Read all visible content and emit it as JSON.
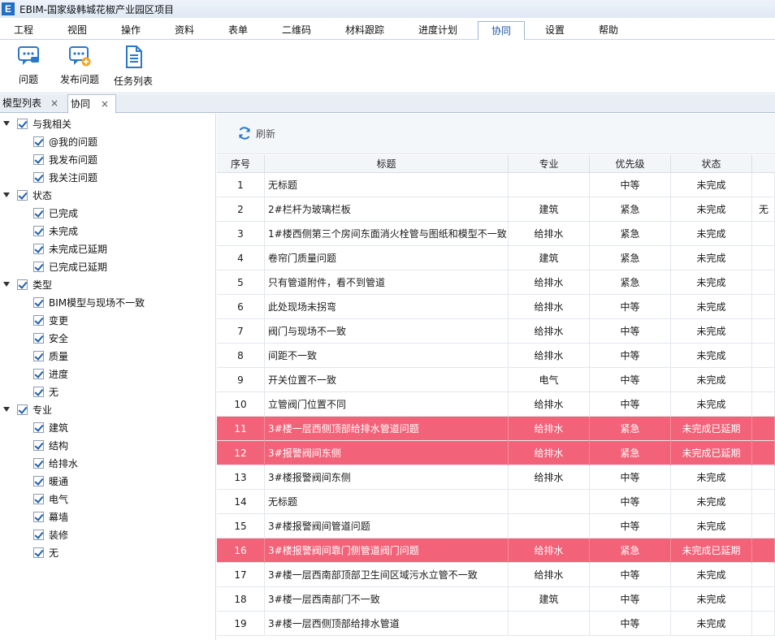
{
  "window": {
    "title": "EBIM-国家级韩城花椒产业园区项目",
    "logo_letter": "E"
  },
  "menu": [
    {
      "label": "工程"
    },
    {
      "label": "视图"
    },
    {
      "label": "操作"
    },
    {
      "label": "资料"
    },
    {
      "label": "表单"
    },
    {
      "label": "二维码"
    },
    {
      "label": "材料跟踪"
    },
    {
      "label": "进度计划"
    },
    {
      "label": "协同",
      "active": true
    },
    {
      "label": "设置"
    },
    {
      "label": "帮助"
    }
  ],
  "ribbon": [
    {
      "label": "问题",
      "icon": "chat-bubble-icon"
    },
    {
      "label": "发布问题",
      "icon": "chat-add-icon"
    },
    {
      "label": "任务列表",
      "icon": "document-list-icon"
    }
  ],
  "doc_tabs": [
    {
      "label": "模型列表",
      "close": "×"
    },
    {
      "label": "协同",
      "close": "×",
      "active": true
    }
  ],
  "tree": {
    "groups": [
      {
        "label": "与我相关",
        "children": [
          "@我的问题",
          "我发布问题",
          "我关注问题"
        ]
      },
      {
        "label": "状态",
        "children": [
          "已完成",
          "未完成",
          "未完成已延期",
          "已完成已延期"
        ]
      },
      {
        "label": "类型",
        "children": [
          "BIM模型与现场不一致",
          "变更",
          "安全",
          "质量",
          "进度",
          "无"
        ]
      },
      {
        "label": "专业",
        "children": [
          "建筑",
          "结构",
          "给排水",
          "暖通",
          "电气",
          "幕墙",
          "装修",
          "无"
        ]
      }
    ]
  },
  "toolbar": {
    "refresh_label": "刷新"
  },
  "grid": {
    "columns": [
      "序号",
      "标题",
      "专业",
      "优先级",
      "状态",
      ""
    ],
    "rows": [
      {
        "no": "1",
        "title": "无标题",
        "disc": "",
        "pri": "中等",
        "status": "未完成",
        "extra": ""
      },
      {
        "no": "2",
        "title": "2#栏杆为玻璃栏板",
        "disc": "建筑",
        "pri": "紧急",
        "status": "未完成",
        "extra": "无"
      },
      {
        "no": "3",
        "title": "1#楼西侧第三个房间东面消火栓管与图纸和模型不一致",
        "disc": "给排水",
        "pri": "紧急",
        "status": "未完成",
        "extra": ""
      },
      {
        "no": "4",
        "title": "卷帘门质量问题",
        "disc": "建筑",
        "pri": "紧急",
        "status": "未完成",
        "extra": ""
      },
      {
        "no": "5",
        "title": "只有管道附件，看不到管道",
        "disc": "给排水",
        "pri": "紧急",
        "status": "未完成",
        "extra": ""
      },
      {
        "no": "6",
        "title": "此处现场未拐弯",
        "disc": "给排水",
        "pri": "中等",
        "status": "未完成",
        "extra": ""
      },
      {
        "no": "7",
        "title": "阀门与现场不一致",
        "disc": "给排水",
        "pri": "中等",
        "status": "未完成",
        "extra": ""
      },
      {
        "no": "8",
        "title": "间距不一致",
        "disc": "给排水",
        "pri": "中等",
        "status": "未完成",
        "extra": ""
      },
      {
        "no": "9",
        "title": "开关位置不一致",
        "disc": "电气",
        "pri": "中等",
        "status": "未完成",
        "extra": ""
      },
      {
        "no": "10",
        "title": "立管阀门位置不同",
        "disc": "给排水",
        "pri": "中等",
        "status": "未完成",
        "extra": ""
      },
      {
        "no": "11",
        "title": " 3#楼一层西侧顶部给排水管道问题",
        "disc": "给排水",
        "pri": "紧急",
        "status": "未完成已延期",
        "extra": "",
        "highlight": true
      },
      {
        "no": "12",
        "title": "3#报警阀间东侧",
        "disc": "给排水",
        "pri": "紧急",
        "status": "未完成已延期",
        "extra": "",
        "highlight": true
      },
      {
        "no": "13",
        "title": "3#楼报警阀间东侧",
        "disc": "给排水",
        "pri": "中等",
        "status": "未完成",
        "extra": ""
      },
      {
        "no": "14",
        "title": "无标题",
        "disc": "",
        "pri": "中等",
        "status": "未完成",
        "extra": ""
      },
      {
        "no": "15",
        "title": "3#楼报警阀间管道问题",
        "disc": "",
        "pri": "中等",
        "status": "未完成",
        "extra": ""
      },
      {
        "no": "16",
        "title": "3#楼报警阀间靠门侧管道阀门问题",
        "disc": "给排水",
        "pri": "紧急",
        "status": "未完成已延期",
        "extra": "",
        "highlight": true
      },
      {
        "no": "17",
        "title": "3#楼一层西南部顶部卫生间区域污水立管不一致",
        "disc": "给排水",
        "pri": "中等",
        "status": "未完成",
        "extra": ""
      },
      {
        "no": "18",
        "title": "3#楼一层西南部门不一致",
        "disc": "建筑",
        "pri": "中等",
        "status": "未完成",
        "extra": ""
      },
      {
        "no": "19",
        "title": "3#楼一层西侧顶部给排水管道",
        "disc": "",
        "pri": "中等",
        "status": "未完成",
        "extra": ""
      }
    ]
  },
  "colors": {
    "highlight_row": "#f26278",
    "accent": "#1f6fc6"
  }
}
